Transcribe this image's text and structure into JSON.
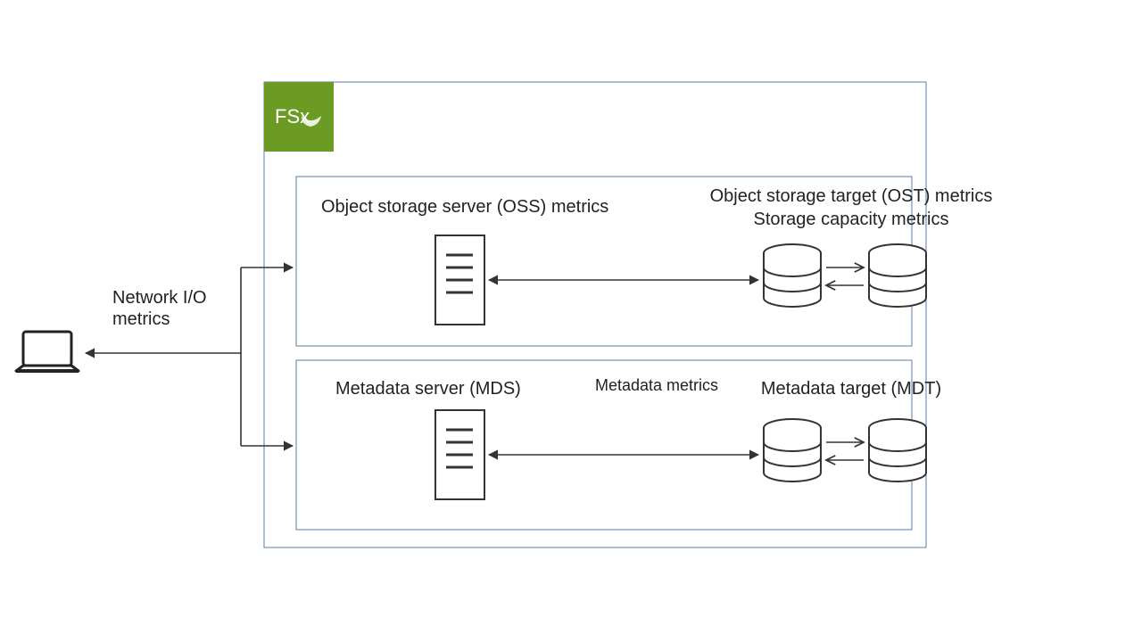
{
  "badge": {
    "text": "FSx"
  },
  "colors": {
    "badge_bg": "#6b9b22",
    "stroke": "#333333",
    "box": "#5b7ea8"
  },
  "labels": {
    "network": "Network I/O",
    "network_sub": "metrics",
    "oss_metrics": "Object storage server (OSS) metrics",
    "ost_metrics": "Object storage target (OST) metrics",
    "storage_capacity": "Storage capacity metrics",
    "mds": "Metadata server (MDS)",
    "mdt": "Metadata target (MDT)",
    "metadata_metrics": "Metadata metrics"
  }
}
